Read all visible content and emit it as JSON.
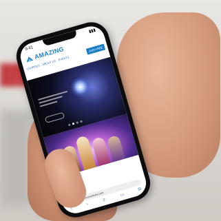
{
  "phone_screen": {
    "status_time": "9:41",
    "status_icons": "▮▮▮",
    "logo_text": "AMAZING",
    "nav": {
      "items": [
        "Courses",
        "About us",
        "Events"
      ],
      "button_label": "Join Free"
    },
    "hero": {
      "carousel_dots": 4,
      "active_dot": 1
    },
    "browser": {
      "url": "amazingdiscoveriestv.com"
    }
  },
  "icons": [
    "logo-icon",
    "reload-icon",
    "back-icon",
    "forward-icon",
    "share-icon",
    "bookmarks-icon",
    "tabs-icon"
  ],
  "colors": {
    "brand": "#1d7fc2",
    "hero_bg": "#0c0d1e",
    "artwork_accent": "#b45fd0",
    "background_red": "#b81f24"
  }
}
